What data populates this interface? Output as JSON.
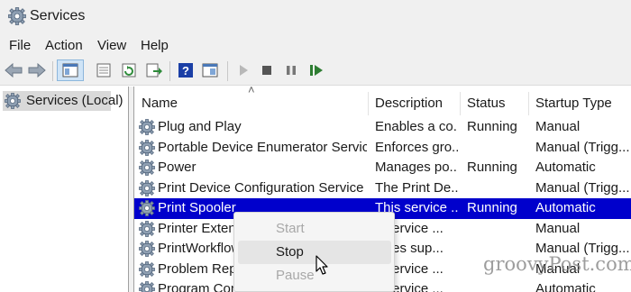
{
  "window": {
    "title": "Services",
    "icon": "gear-icon"
  },
  "menu": {
    "items": [
      "File",
      "Action",
      "View",
      "Help"
    ]
  },
  "toolbar": {
    "buttons": [
      "back-arrow-icon",
      "forward-arrow-icon",
      "show-hide-tree-icon",
      "properties-icon",
      "refresh-icon",
      "export-list-icon",
      "help-icon",
      "view-icon",
      "start-service-icon",
      "stop-service-icon",
      "pause-service-icon",
      "restart-service-icon"
    ]
  },
  "tree": {
    "root_label": "Services (Local)"
  },
  "list": {
    "columns": [
      "Name",
      "Description",
      "Status",
      "Startup Type"
    ],
    "rows": [
      {
        "name": "Plug and Play",
        "description": "Enables a co...",
        "status": "Running",
        "startup": "Manual"
      },
      {
        "name": "Portable Device Enumerator Service",
        "description": "Enforces gro...",
        "status": "",
        "startup": "Manual (Trigg..."
      },
      {
        "name": "Power",
        "description": "Manages po...",
        "status": "Running",
        "startup": "Automatic"
      },
      {
        "name": "Print Device Configuration Service",
        "description": "The Print De...",
        "status": "",
        "startup": "Manual (Trigg..."
      },
      {
        "name": "Print Spooler",
        "description": "This service ...",
        "status": "Running",
        "startup": "Automatic",
        "selected": true
      },
      {
        "name": "Printer Extensi",
        "description": "s service ...",
        "status": "",
        "startup": "Manual"
      },
      {
        "name": "PrintWorkflow",
        "description": "vides sup...",
        "status": "",
        "startup": "Manual (Trigg..."
      },
      {
        "name": "Problem Repo",
        "description": "s service ...",
        "status": "",
        "startup": "Manual"
      },
      {
        "name": "Program Com",
        "description": "s service ...",
        "status": "",
        "startup": "Automatic"
      }
    ]
  },
  "context_menu": {
    "items": [
      {
        "label": "Start",
        "enabled": false
      },
      {
        "label": "Stop",
        "enabled": true,
        "hovered": true
      },
      {
        "label": "Pause",
        "enabled": false
      }
    ]
  },
  "watermark": "groovyPost.com",
  "colors": {
    "selection": "#0000cc",
    "chrome": "#f0f0f0",
    "play": "#2e7d32",
    "help": "#1b3fa6"
  }
}
